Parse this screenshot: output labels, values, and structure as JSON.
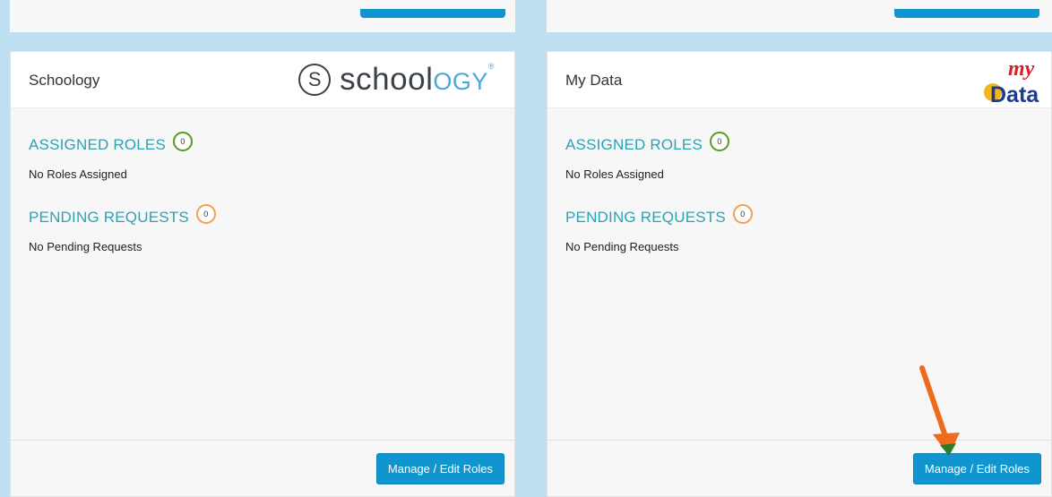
{
  "cards": [
    {
      "title": "Schoology",
      "logo": {
        "icon": "s-circle-icon",
        "word_main": "school",
        "word_accent": "OGY",
        "mark": "®"
      },
      "assigned": {
        "label": "ASSIGNED ROLES",
        "count": "0",
        "note": "No Roles Assigned"
      },
      "pending": {
        "label": "PENDING REQUESTS",
        "count": "0",
        "note": "No Pending Requests"
      },
      "button": "Manage / Edit Roles"
    },
    {
      "title": "My Data",
      "logo": {
        "top": "my",
        "bottom": "Data"
      },
      "assigned": {
        "label": "ASSIGNED ROLES",
        "count": "0",
        "note": "No Roles Assigned"
      },
      "pending": {
        "label": "PENDING REQUESTS",
        "count": "0",
        "note": "No Pending Requests"
      },
      "button": "Manage / Edit Roles"
    }
  ],
  "colors": {
    "background": "#bfe0f1",
    "accent_text": "#2aa3b5",
    "button": "#1195cf",
    "badge_assigned": "#5c9a1c",
    "badge_pending": "#f0a050",
    "annotation_arrow": "#ef6a1c"
  },
  "annotation": {
    "icon": "arrow-pointer-icon"
  }
}
